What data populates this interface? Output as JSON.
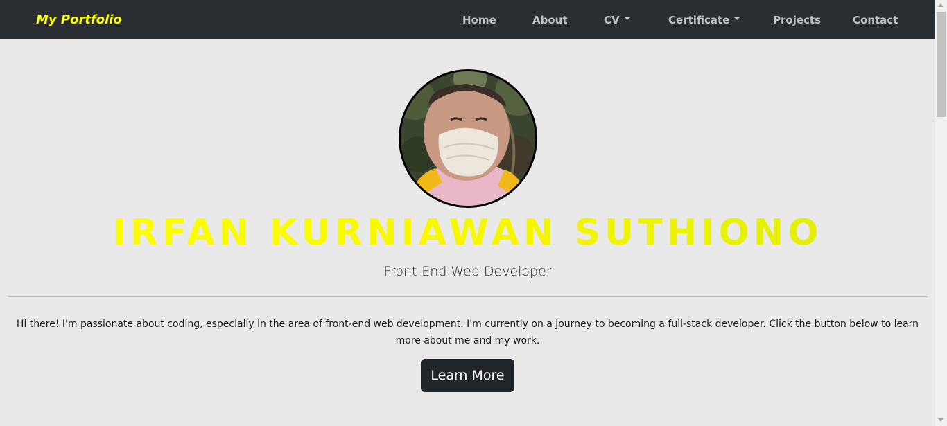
{
  "navbar": {
    "brand": "My Portfolio",
    "items": [
      {
        "label": "Home",
        "dropdown": false
      },
      {
        "label": "About",
        "dropdown": false
      },
      {
        "label": "CV",
        "dropdown": true
      },
      {
        "label": "Certificate",
        "dropdown": true
      },
      {
        "label": "Projects",
        "dropdown": false
      },
      {
        "label": "Contact",
        "dropdown": false
      }
    ]
  },
  "hero": {
    "name": "IRFAN KURNIAWAN SUTHIONO",
    "role": "Front-End Web Developer",
    "intro": "Hi there! I'm passionate about coding, especially in the area of front-end web development. I'm currently on a journey to becoming a full-stack developer. Click the button below to learn more about me and my work.",
    "button_label": "Learn More"
  },
  "colors": {
    "navbar_bg": "#2a2e33",
    "brand": "#ffff00",
    "page_bg": "#e9e9e9",
    "button_bg": "#212529"
  },
  "icons": {
    "dropdown": "caret-down-icon",
    "avatar": "profile-photo"
  }
}
